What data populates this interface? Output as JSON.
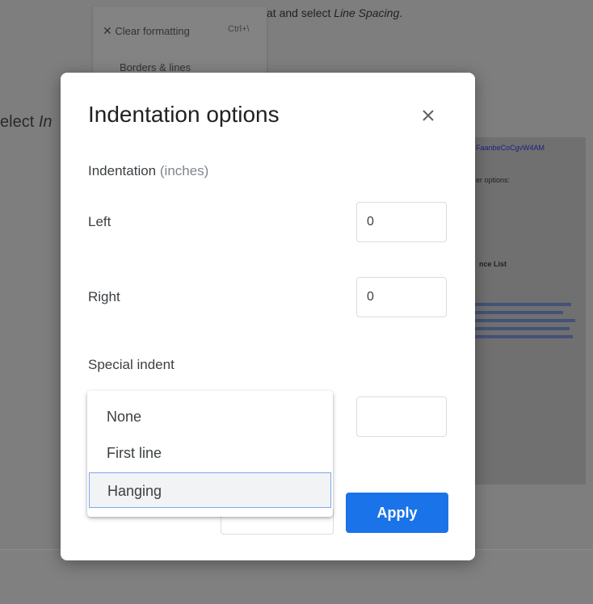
{
  "background": {
    "menu": {
      "clear_formatting": "Clear formatting",
      "clear_formatting_shortcut": "Ctrl+\\",
      "borders_lines": "Borders & lines",
      "borders_arrow": "▸"
    },
    "instruction_fragment": "at and select ",
    "instruction_italic": "Line Spacing",
    "instruction_end": ".",
    "select_fragment": "elect ",
    "select_italic": "In",
    "screenshot_texts": [
      "FaanbeCoCgvW4AM",
      "er options:",
      "nce List"
    ]
  },
  "dialog": {
    "title": "Indentation options",
    "indentation_heading": "Indentation",
    "indentation_unit": "(inches)",
    "left_label": "Left",
    "left_value": "0",
    "right_label": "Right",
    "right_value": "0",
    "special_indent_label": "Special indent",
    "special_indent_value": "",
    "dropdown_options": [
      "None",
      "First line",
      "Hanging"
    ],
    "selected_option": "Hanging",
    "apply_label": "Apply"
  }
}
